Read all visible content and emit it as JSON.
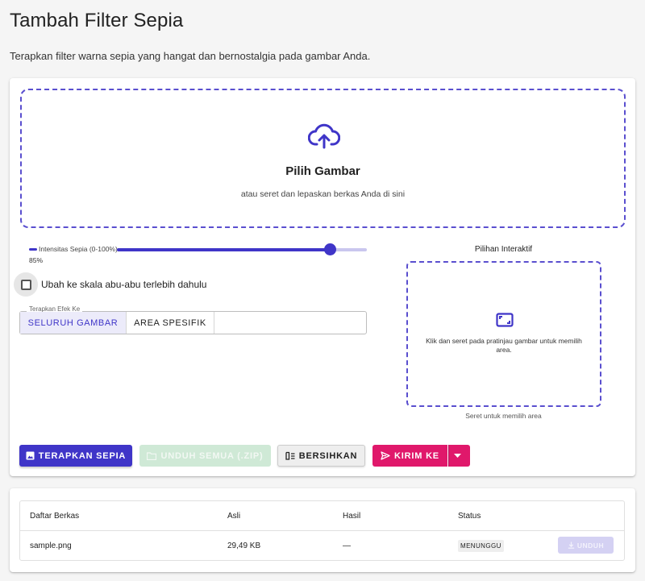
{
  "page": {
    "title": "Tambah Filter Sepia",
    "description": "Terapkan filter warna sepia yang hangat dan bernostalgia pada gambar Anda."
  },
  "upload": {
    "title": "Pilih Gambar",
    "subtitle": "atau seret dan lepaskan berkas Anda di sini",
    "icon": "cloud-upload-icon"
  },
  "intensity": {
    "label": "Intensitas Sepia (0-100%)",
    "value_text": "85%",
    "value": 85
  },
  "grayscale": {
    "label": "Ubah ke skala abu-abu terlebih dahulu",
    "checked": false
  },
  "apply_to": {
    "legend": "Terapkan Efek Ke",
    "options": [
      "SELURUH GAMBAR",
      "AREA SPESIFIK"
    ],
    "selected": "SELURUH GAMBAR"
  },
  "interactive": {
    "title": "Pilihan Interaktif",
    "text": "Klik dan seret pada pratinjau gambar untuk memilih area.",
    "caption": "Seret untuk memilih area",
    "icon": "crop-frame-icon"
  },
  "actions": {
    "apply": "TERAPKAN SEPIA",
    "download_all": "UNDUH SEMUA (.ZIP)",
    "clear": "BERSIHKAN",
    "send": "KIRIM KE"
  },
  "files": {
    "headers": [
      "Daftar Berkas",
      "Asli",
      "Hasil",
      "Status"
    ],
    "rows": [
      {
        "name": "sample.png",
        "original": "29,49 KB",
        "result": "—",
        "status": "MENUNGGU",
        "action": "UNDUH"
      }
    ]
  },
  "colors": {
    "primary": "#3f35c8",
    "accent": "#e0186b",
    "success_disabled": "#cfe9d6"
  }
}
